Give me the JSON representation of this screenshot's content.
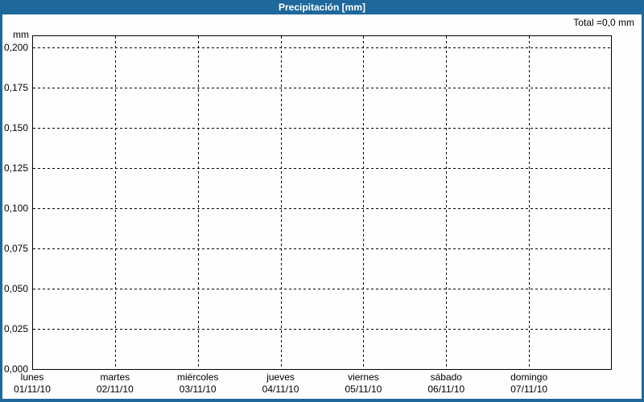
{
  "header": {
    "title": "Precipitación [mm]",
    "total_label": "Total =0,0 mm"
  },
  "chart_data": {
    "type": "bar",
    "title": "Precipitación [mm]",
    "total_annotation": "Total =0,0 mm",
    "y_axis": {
      "unit": "mm",
      "min": 0.0,
      "max": 0.2075,
      "tick_step": 0.025,
      "tick_labels": [
        "0,200",
        "0,175",
        "0,150",
        "0,125",
        "0,100",
        "0,075",
        "0,050",
        "0,025",
        "0,000"
      ],
      "tick_values": [
        0.2,
        0.175,
        0.15,
        0.125,
        0.1,
        0.075,
        0.05,
        0.025,
        0.0
      ]
    },
    "x_axis": {
      "categories": [
        {
          "day": "lunes",
          "date": "01/11/10"
        },
        {
          "day": "martes",
          "date": "02/11/10"
        },
        {
          "day": "miércoles",
          "date": "03/11/10"
        },
        {
          "day": "jueves",
          "date": "04/11/10"
        },
        {
          "day": "viernes",
          "date": "05/11/10"
        },
        {
          "day": "sábado",
          "date": "06/11/10"
        },
        {
          "day": "domingo",
          "date": "07/11/10"
        }
      ]
    },
    "series": [
      {
        "name": "Precipitación",
        "values": [
          0,
          0,
          0,
          0,
          0,
          0,
          0
        ]
      }
    ],
    "grid": "dashed",
    "legend_position": "none"
  },
  "colors": {
    "header_bg": "#1F689C",
    "window_border": "#1F689C",
    "grid_line": "#000000",
    "axis_text": "#000000",
    "title_text": "#FFFFFF"
  }
}
